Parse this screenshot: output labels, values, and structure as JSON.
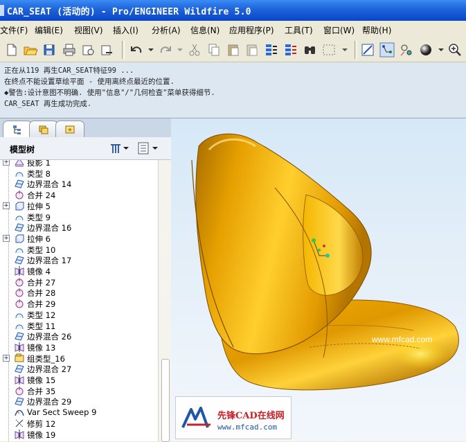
{
  "window": {
    "title": "CAR_SEAT (活动的) - Pro/ENGINEER Wildfire 5.0"
  },
  "menu": [
    {
      "label": "文件(F)"
    },
    {
      "label": "编辑(E)"
    },
    {
      "label": "视图(V)"
    },
    {
      "label": "插入(I)"
    },
    {
      "label": "分析(A)"
    },
    {
      "label": "信息(N)"
    },
    {
      "label": "应用程序(P)"
    },
    {
      "label": "工具(T)"
    },
    {
      "label": "窗口(W)"
    },
    {
      "label": "帮助(H)"
    }
  ],
  "messages": [
    "正在从119 再生CAR_SEAT特征99 ...",
    "在终点不能设置草绘平面 - 使用离终点最近的位置.",
    "◆警告:设计意图不明确. 使用\"信息\"/\"几何检查\"菜单获得细节.",
    "CAR_SEAT 再生成功完成."
  ],
  "model_tree": {
    "title": "模型树",
    "items": [
      {
        "label": "投影 1",
        "icon": "projection-icon",
        "expand": "+"
      },
      {
        "label": "类型 8",
        "icon": "surface-type-icon",
        "expand": ""
      },
      {
        "label": "边界混合 14",
        "icon": "boundary-blend-icon",
        "expand": ""
      },
      {
        "label": "合并 24",
        "icon": "merge-icon",
        "expand": ""
      },
      {
        "label": "拉伸 5",
        "icon": "extrude-icon",
        "expand": "+"
      },
      {
        "label": "类型 9",
        "icon": "surface-type-icon",
        "expand": ""
      },
      {
        "label": "边界混合 16",
        "icon": "boundary-blend-icon",
        "expand": ""
      },
      {
        "label": "拉伸 6",
        "icon": "extrude-icon",
        "expand": "+"
      },
      {
        "label": "类型 10",
        "icon": "surface-type-icon",
        "expand": ""
      },
      {
        "label": "边界混合 17",
        "icon": "boundary-blend-icon",
        "expand": ""
      },
      {
        "label": "镜像 4",
        "icon": "mirror-icon",
        "expand": ""
      },
      {
        "label": "合并 27",
        "icon": "merge-icon",
        "expand": ""
      },
      {
        "label": "合并 28",
        "icon": "merge-icon",
        "expand": ""
      },
      {
        "label": "合并 29",
        "icon": "merge-icon",
        "expand": ""
      },
      {
        "label": "类型 12",
        "icon": "surface-type-icon",
        "expand": ""
      },
      {
        "label": "类型 11",
        "icon": "surface-type-icon",
        "expand": ""
      },
      {
        "label": "边界混合 26",
        "icon": "boundary-blend-icon",
        "expand": ""
      },
      {
        "label": "镜像 13",
        "icon": "mirror-icon",
        "expand": ""
      },
      {
        "label": "组类型_16",
        "icon": "group-icon",
        "expand": "+"
      },
      {
        "label": "边界混合 27",
        "icon": "boundary-blend-icon",
        "expand": ""
      },
      {
        "label": "镜像 15",
        "icon": "mirror-icon",
        "expand": ""
      },
      {
        "label": "合并 35",
        "icon": "merge-icon",
        "expand": ""
      },
      {
        "label": "边界混合 29",
        "icon": "boundary-blend-icon",
        "expand": ""
      },
      {
        "label": "Var Sect Sweep 9",
        "icon": "var-sect-sweep-icon",
        "expand": ""
      },
      {
        "label": "修剪 12",
        "icon": "trim-icon",
        "expand": ""
      },
      {
        "label": "镜像 19",
        "icon": "mirror-icon",
        "expand": ""
      }
    ]
  },
  "viewport": {
    "watermark": "www.mfcad.com",
    "logo_text": "先锋CAD在线网",
    "logo_url": "www.mfcad.com",
    "model_color": "#e5a000"
  }
}
